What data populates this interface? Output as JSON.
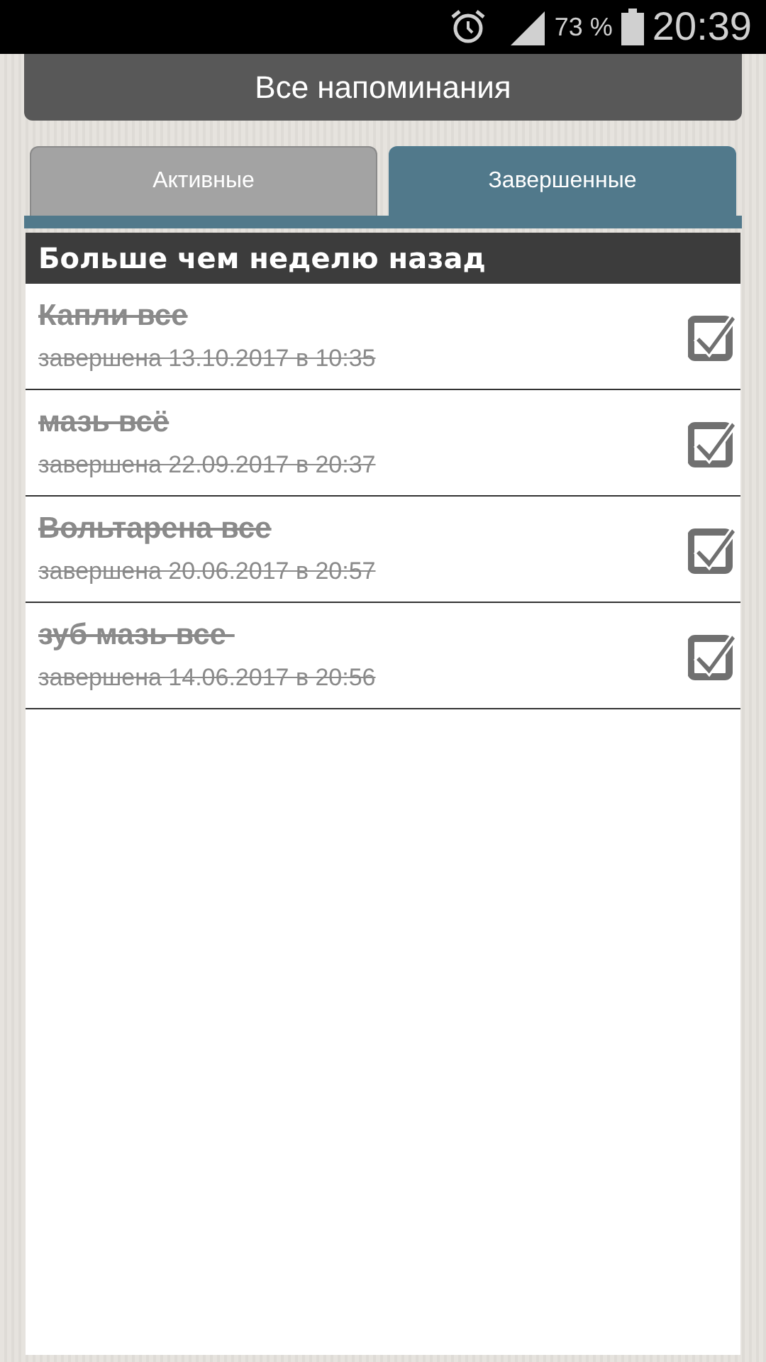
{
  "status_bar": {
    "battery": "73 %",
    "time": "20:39"
  },
  "header": {
    "title": "Все напоминания"
  },
  "tabs": [
    {
      "label": "Активные",
      "selected": false
    },
    {
      "label": "Завершенные",
      "selected": true
    }
  ],
  "section": {
    "title": "Больше чем неделю назад"
  },
  "reminders": [
    {
      "title": "Капли все",
      "subtitle": "завершена 13.10.2017 в 10:35",
      "checked": true
    },
    {
      "title": "мазь всё",
      "subtitle": "завершена 22.09.2017 в 20:37",
      "checked": true
    },
    {
      "title": "Вольтарена все",
      "subtitle": "завершена 20.06.2017 в 20:57",
      "checked": true
    },
    {
      "title": "зуб мазь все ",
      "subtitle": "завершена 14.06.2017 в 20:56",
      "checked": true
    }
  ]
}
